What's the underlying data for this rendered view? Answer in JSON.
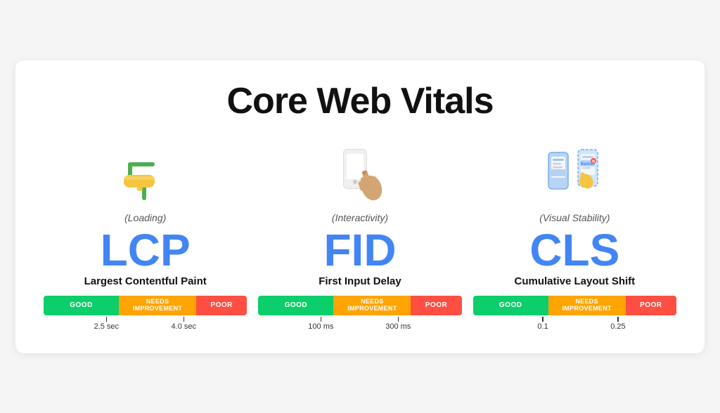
{
  "page": {
    "title": "Core Web Vitals",
    "background": "#f5f5f5"
  },
  "vitals": [
    {
      "id": "lcp",
      "icon": "paint-roller",
      "subtitle": "(Loading)",
      "abbr": "LCP",
      "name": "Largest Contentful Paint",
      "bar": {
        "good_label": "GOOD",
        "needs_label": "NEEDS IMPROVEMENT",
        "poor_label": "POOR",
        "good_pct": 37,
        "needs_pct": 38,
        "poor_pct": 25
      },
      "tick1": "2.5 sec",
      "tick2": "4.0 sec"
    },
    {
      "id": "fid",
      "icon": "phone-tap",
      "subtitle": "(Interactivity)",
      "abbr": "FID",
      "name": "First Input Delay",
      "bar": {
        "good_label": "GOOD",
        "needs_label": "NEEDS IMPROVEMENT",
        "poor_label": "POOR",
        "good_pct": 37,
        "needs_pct": 38,
        "poor_pct": 25
      },
      "tick1": "100 ms",
      "tick2": "300 ms"
    },
    {
      "id": "cls",
      "icon": "layout-shift",
      "subtitle": "(Visual Stability)",
      "abbr": "CLS",
      "name": "Cumulative Layout Shift",
      "bar": {
        "good_label": "GOOD",
        "needs_label": "NEEDS IMPROVEMENT",
        "poor_label": "POOR",
        "good_pct": 37,
        "needs_pct": 38,
        "poor_pct": 25
      },
      "tick1": "0.1",
      "tick2": "0.25"
    }
  ]
}
